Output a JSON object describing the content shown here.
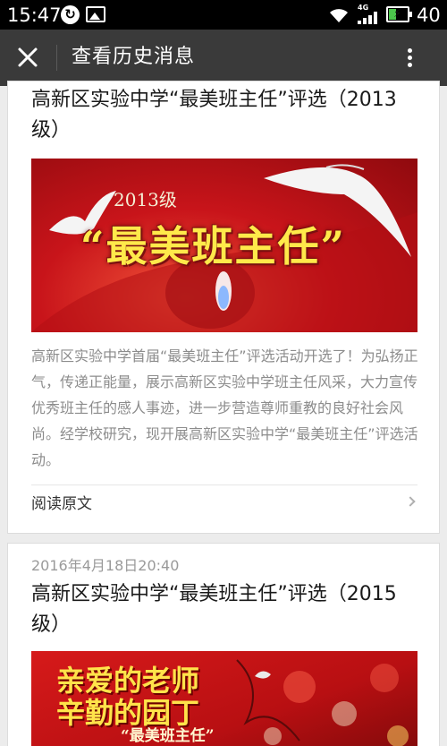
{
  "status_bar": {
    "time": "15:47",
    "network": "4G",
    "battery_level": "40",
    "battery_fraction": 0.4,
    "icons": [
      "sync-icon",
      "gallery-icon",
      "wifi-icon",
      "signal-icon",
      "battery-charging-icon"
    ]
  },
  "header": {
    "close_icon": "close-icon",
    "title": "查看历史消息",
    "more_icon": "more-vertical-icon"
  },
  "articles": [
    {
      "title": "高新区实验中学“最美班主任”评选（2013级）",
      "banner": {
        "year": "2013级",
        "headline": "“最美班主任”"
      },
      "description": "高新区实验中学首届“最美班主任”评选活动开选了！为弘扬正气，传递正能量，展示高新区实验中学班主任风采，大力宣传优秀班主任的感人事迹，进一步营造尊师重教的良好社会风尚。经学校研究，现开展高新区实验中学“最美班主任”评选活动。",
      "read_more": "阅读原文"
    },
    {
      "date": "2016年4月18日20:40",
      "title": "高新区实验中学“最美班主任”评选（2015级）",
      "banner": {
        "line1": "亲爱的老师",
        "line2": "辛勤的园丁",
        "sub": "“最美班主任”"
      }
    }
  ],
  "colors": {
    "status_bar_bg": "#000000",
    "title_bar_bg": "#3a3a3a",
    "page_bg": "#ececec",
    "banner_red": "#c8141a",
    "banner_gold": "#ffe94a",
    "battery_green": "#4cc64c"
  }
}
